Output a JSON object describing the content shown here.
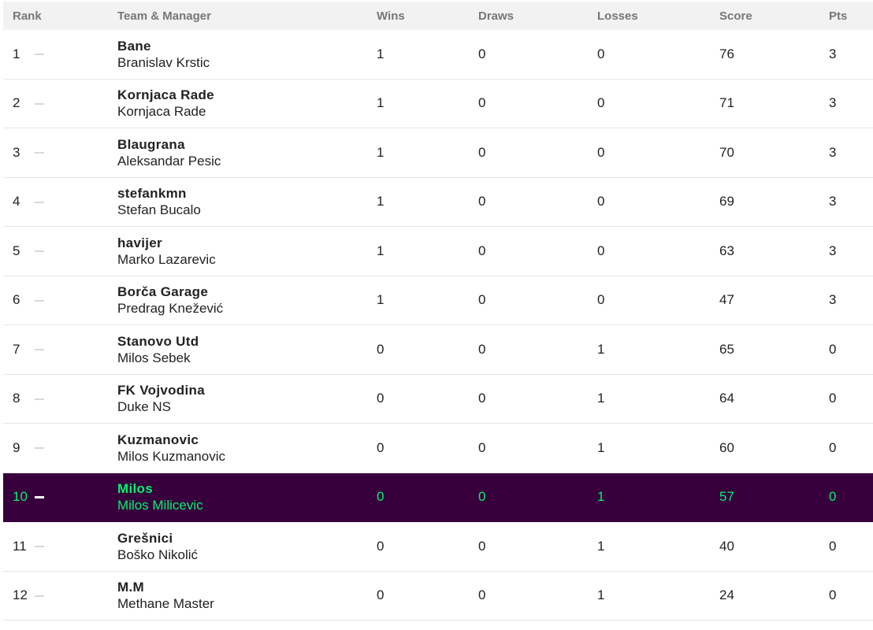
{
  "headers": {
    "rank": "Rank",
    "team_manager": "Team & Manager",
    "wins": "Wins",
    "draws": "Draws",
    "losses": "Losses",
    "score": "Score",
    "pts": "Pts"
  },
  "colors": {
    "highlight_bg": "#37003c",
    "highlight_text": "#05f26c",
    "header_bg": "#f2f2f2"
  },
  "rows": [
    {
      "rank": "1",
      "team": "Bane",
      "manager": "Branislav Krstic",
      "wins": "1",
      "draws": "0",
      "losses": "0",
      "score": "76",
      "pts": "3"
    },
    {
      "rank": "2",
      "team": "Kornjaca Rade",
      "manager": "Kornjaca Rade",
      "wins": "1",
      "draws": "0",
      "losses": "0",
      "score": "71",
      "pts": "3"
    },
    {
      "rank": "3",
      "team": "Blaugrana",
      "manager": "Aleksandar Pesic",
      "wins": "1",
      "draws": "0",
      "losses": "0",
      "score": "70",
      "pts": "3"
    },
    {
      "rank": "4",
      "team": "stefankmn",
      "manager": "Stefan Bucalo",
      "wins": "1",
      "draws": "0",
      "losses": "0",
      "score": "69",
      "pts": "3"
    },
    {
      "rank": "5",
      "team": "havijer",
      "manager": "Marko Lazarevic",
      "wins": "1",
      "draws": "0",
      "losses": "0",
      "score": "63",
      "pts": "3"
    },
    {
      "rank": "6",
      "team": "Borča Garage",
      "manager": "Predrag Knežević",
      "wins": "1",
      "draws": "0",
      "losses": "0",
      "score": "47",
      "pts": "3"
    },
    {
      "rank": "7",
      "team": "Stanovo Utd",
      "manager": "Milos Sebek",
      "wins": "0",
      "draws": "0",
      "losses": "1",
      "score": "65",
      "pts": "0"
    },
    {
      "rank": "8",
      "team": "FK Vojvodina",
      "manager": "Duke NS",
      "wins": "0",
      "draws": "0",
      "losses": "1",
      "score": "64",
      "pts": "0"
    },
    {
      "rank": "9",
      "team": "Kuzmanovic",
      "manager": "Milos Kuzmanovic",
      "wins": "0",
      "draws": "0",
      "losses": "1",
      "score": "60",
      "pts": "0"
    },
    {
      "rank": "10",
      "team": "Milos",
      "manager": "Milos Milicevic",
      "wins": "0",
      "draws": "0",
      "losses": "1",
      "score": "57",
      "pts": "0"
    },
    {
      "rank": "11",
      "team": "Grešnici",
      "manager": "Boško Nikolić",
      "wins": "0",
      "draws": "0",
      "losses": "1",
      "score": "40",
      "pts": "0"
    },
    {
      "rank": "12",
      "team": "M.M",
      "manager": "Methane Master",
      "wins": "0",
      "draws": "0",
      "losses": "1",
      "score": "24",
      "pts": "0"
    }
  ]
}
